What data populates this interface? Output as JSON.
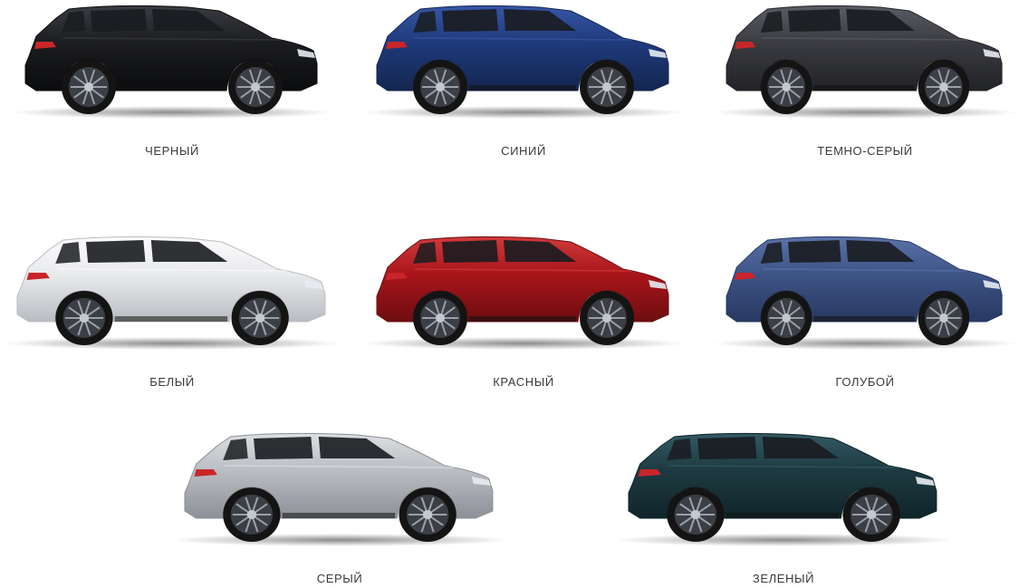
{
  "colors": [
    {
      "label": "ЧЕРНЫЙ",
      "body": "#1b1c1f",
      "shade": "#0b0c0e",
      "light": "#3a3c42"
    },
    {
      "label": "СИНИЙ",
      "body": "#1f3a7a",
      "shade": "#142650",
      "light": "#3656a6"
    },
    {
      "label": "ТЕМНО-СЕРЫЙ",
      "body": "#3a3b40",
      "shade": "#222327",
      "light": "#5a5c63"
    },
    {
      "label": "БЕЛЫЙ",
      "body": "#e9eaec",
      "shade": "#b9bcc2",
      "light": "#fbfbfc"
    },
    {
      "label": "КРАСНЫЙ",
      "body": "#a8151a",
      "shade": "#6d0d10",
      "light": "#d03a3a"
    },
    {
      "label": "ГОЛУБОЙ",
      "body": "#3e5486",
      "shade": "#283861",
      "light": "#5b72a8"
    },
    {
      "label": "СЕРЫЙ",
      "body": "#b9bcc1",
      "shade": "#8d9096",
      "light": "#dcdee1"
    },
    {
      "label": "ЗЕЛЕНЫЙ",
      "body": "#1d3940",
      "shade": "#10252a",
      "light": "#325a63"
    }
  ]
}
